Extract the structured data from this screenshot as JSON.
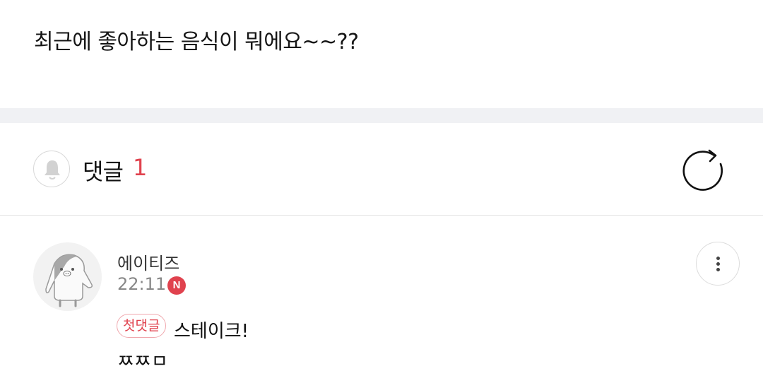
{
  "post": {
    "text": "최근에 좋아하는 음식이 뭐에요~~??"
  },
  "comments_header": {
    "title": "댓글",
    "count": "1",
    "bell_icon": "bell-icon",
    "refresh_icon": "refresh-icon"
  },
  "comment": {
    "author": "에이티즈",
    "time": "22:11",
    "new_badge": "N",
    "first_badge": "첫댓글",
    "text": "스테이크!",
    "text_line2": "ㅉㅉㅁ",
    "more_icon": "more-vertical-icon"
  },
  "colors": {
    "accent": "#e0424e",
    "divider": "#f0f1f4"
  }
}
